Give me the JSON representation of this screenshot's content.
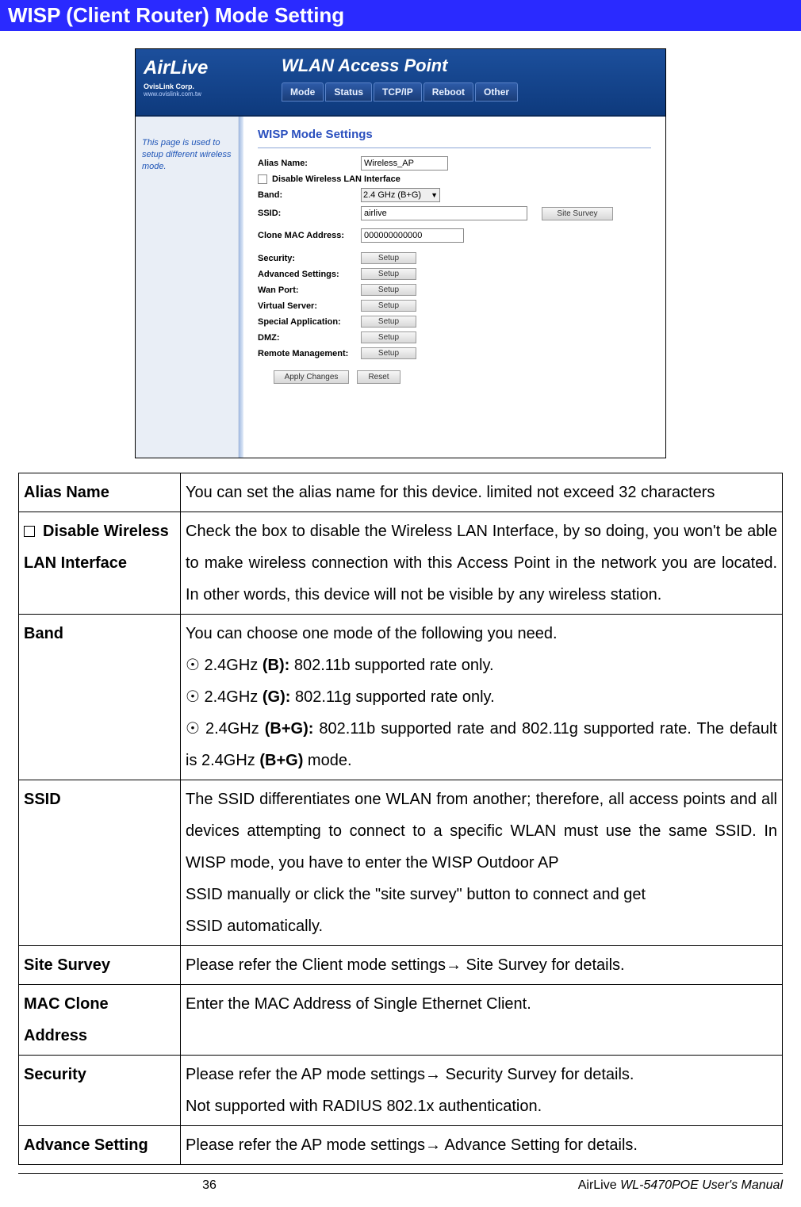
{
  "section": {
    "title": "WISP (Client Router) Mode Setting"
  },
  "ap_ui": {
    "logo": {
      "brand": "AirLive",
      "corp": "OvisLink Corp.",
      "url": "www.ovislink.com.tw"
    },
    "header_title": "WLAN Access Point",
    "tabs": [
      "Mode",
      "Status",
      "TCP/IP",
      "Reboot",
      "Other"
    ],
    "sidebar_text": "This page is used to setup different wireless mode.",
    "section_title": "WISP Mode Settings",
    "fields": {
      "alias_label": "Alias Name:",
      "alias_value": "Wireless_AP",
      "disable_label": "Disable Wireless LAN Interface",
      "band_label": "Band:",
      "band_value": "2.4 GHz (B+G)",
      "ssid_label": "SSID:",
      "ssid_value": "airlive",
      "site_survey_btn": "Site Survey",
      "clone_label": "Clone MAC Address:",
      "clone_value": "000000000000",
      "security_label": "Security:",
      "adv_label": "Advanced Settings:",
      "wan_label": "Wan Port:",
      "vs_label": "Virtual Server:",
      "sa_label": "Special Application:",
      "dmz_label": "DMZ:",
      "rm_label": "Remote Management:",
      "setup_btn": "Setup",
      "apply_btn": "Apply Changes",
      "reset_btn": "Reset"
    }
  },
  "table": {
    "rows": {
      "alias": {
        "label": "Alias Name",
        "desc": "You can set the alias name for this device. limited not exceed 32 characters"
      },
      "disable": {
        "label": "Disable Wireless LAN Interface",
        "desc": "Check the box to disable the Wireless LAN Interface, by so doing, you won't be able to make wireless connection with this Access Point in the network you are located. In other words, this device will not be visible by any wireless station."
      },
      "band": {
        "label": "Band",
        "intro": "You can choose one mode of the following you need.",
        "opt1_pre": "2.4GHz ",
        "opt1_bold": "(B):",
        "opt1_post": " 802.11b supported rate only.",
        "opt2_pre": "2.4GHz ",
        "opt2_bold": "(G):",
        "opt2_post": " 802.11g supported rate only.",
        "opt3_pre": " 2.4GHz ",
        "opt3_bold": "(B+G):",
        "opt3_post": " 802.11b supported rate and 802.11g supported rate. The default is 2.4GHz ",
        "opt3_bold2": "(B+G)",
        "opt3_tail": " mode."
      },
      "ssid": {
        "label": "SSID",
        "desc": "The SSID differentiates one WLAN from another; therefore, all access points and all devices attempting to connect to a specific WLAN must use the same SSID. In WISP mode, you have to enter the WISP Outdoor AP",
        "desc2": "SSID manually or click the \"site survey\" button to connect and get",
        "desc3": "SSID automatically."
      },
      "sitesurvey": {
        "label": "Site Survey",
        "desc": "Please refer the Client mode settings→ Site Survey for details."
      },
      "mac": {
        "label": "MAC Clone Address",
        "desc": "Enter the MAC Address of Single Ethernet Client."
      },
      "security": {
        "label": "Security",
        "desc": "Please refer the AP mode settings→ Security Survey for details.",
        "desc2": "Not supported with RADIUS 802.1x authentication."
      },
      "advance": {
        "label": "Advance Setting",
        "desc": "Please refer the AP mode settings→ Advance Setting for details."
      }
    }
  },
  "footer": {
    "page": "36",
    "right_pre": "AirLive ",
    "right_model": "WL-5470POE",
    "right_post": " User's Manual"
  }
}
